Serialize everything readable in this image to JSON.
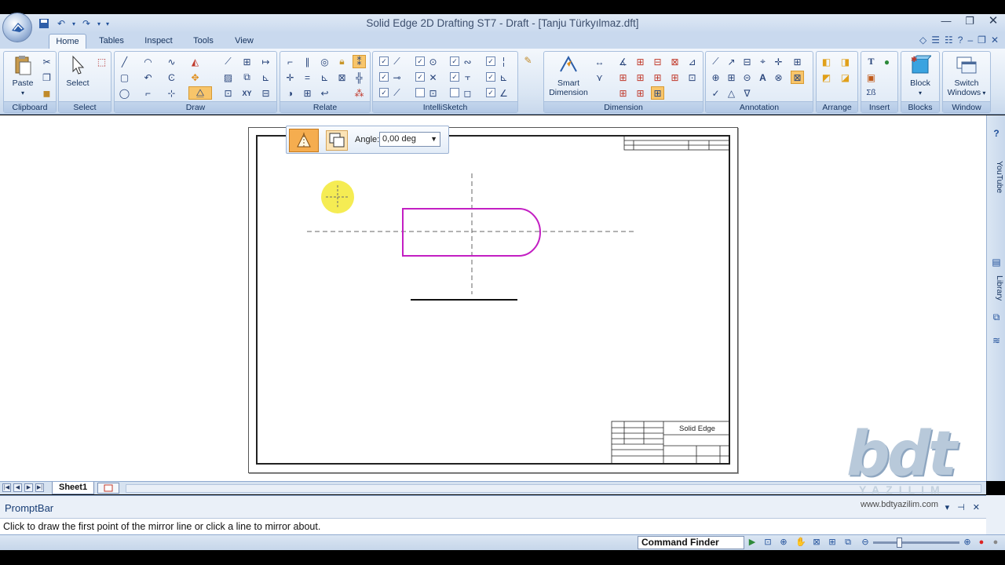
{
  "window": {
    "title": "Solid Edge 2D Drafting ST7 - Draft - [Tanju Türkyılmaz.dft]"
  },
  "tabs": [
    {
      "label": "Home",
      "active": true
    },
    {
      "label": "Tables"
    },
    {
      "label": "Inspect"
    },
    {
      "label": "Tools"
    },
    {
      "label": "View"
    }
  ],
  "ribbon": {
    "clipboard": {
      "label": "Clipboard",
      "paste": "Paste"
    },
    "select": {
      "label": "Select",
      "select": "Select"
    },
    "draw": {
      "label": "Draw"
    },
    "relate": {
      "label": "Relate"
    },
    "intellisketch": {
      "label": "IntelliSketch"
    },
    "dimension": {
      "label": "Dimension",
      "smart_dimension": "Smart Dimension"
    },
    "annotation": {
      "label": "Annotation"
    },
    "arrange": {
      "label": "Arrange"
    },
    "insert": {
      "label": "Insert"
    },
    "blocks": {
      "label": "Blocks",
      "block": "Block"
    },
    "window": {
      "label": "Window",
      "switch_windows": "Switch Windows"
    }
  },
  "mirror_toolbar": {
    "angle_label": "Angle:",
    "angle_value": "0,00 deg"
  },
  "title_block": {
    "brand": "Solid Edge"
  },
  "side_panel": {
    "youtube": "YouTube",
    "library": "Library"
  },
  "sheet_tabs": {
    "active": "Sheet1"
  },
  "promptbar": {
    "title": "PromptBar",
    "message": "Click to draw the first point of the mirror line or click a line to mirror about."
  },
  "statusbar": {
    "command_finder": "Command Finder"
  },
  "watermark": {
    "logo": "bdt",
    "sub": "YAZILIM",
    "url": "www.bdtyazilim.com"
  },
  "colors": {
    "sketch_magenta": "#c31fc3",
    "ribbon_blue": "#c9d9ee",
    "highlight_orange": "#f5ad4f",
    "cursor_yellow": "#f5ec4a"
  }
}
